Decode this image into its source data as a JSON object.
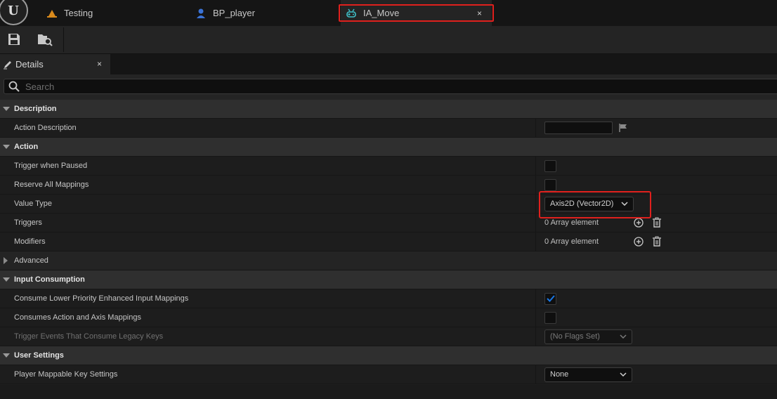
{
  "tabs": [
    {
      "label": "Testing",
      "icon": "level-icon",
      "active": false
    },
    {
      "label": "BP_player",
      "icon": "blueprint-actor-icon",
      "active": false
    },
    {
      "label": "IA_Move",
      "icon": "input-action-icon",
      "active": true,
      "close": "×"
    }
  ],
  "toolbar": {
    "save_icon": "save-icon",
    "browse_icon": "browse-to-asset-icon"
  },
  "details_panel": {
    "tab_label": "Details",
    "tab_icon": "pencil-icon",
    "close": "×"
  },
  "search": {
    "placeholder": "Search"
  },
  "categories": {
    "description": {
      "label": "Description",
      "action_description": {
        "label": "Action Description",
        "value": ""
      }
    },
    "action": {
      "label": "Action",
      "trigger_when_paused": {
        "label": "Trigger when Paused",
        "checked": false
      },
      "reserve_all_mappings": {
        "label": "Reserve All Mappings",
        "checked": false
      },
      "value_type": {
        "label": "Value Type",
        "value": "Axis2D (Vector2D)"
      },
      "triggers": {
        "label": "Triggers",
        "value": "0 Array element"
      },
      "modifiers": {
        "label": "Modifiers",
        "value": "0 Array element"
      },
      "advanced": {
        "label": "Advanced"
      }
    },
    "input_consumption": {
      "label": "Input Consumption",
      "consume_lower_priority": {
        "label": "Consume Lower Priority Enhanced Input Mappings",
        "checked": true
      },
      "consumes_action_axis": {
        "label": "Consumes Action and Axis Mappings",
        "checked": false
      },
      "trigger_events_legacy": {
        "label": "Trigger Events That Consume Legacy Keys",
        "value": "(No Flags Set)",
        "enabled": false
      }
    },
    "user_settings": {
      "label": "User Settings",
      "player_mappable": {
        "label": "Player Mappable Key Settings",
        "value": "None"
      }
    }
  },
  "colors": {
    "accent": "#1a78e5",
    "highlight": "#e0201d",
    "background": "#1f1f1f"
  }
}
